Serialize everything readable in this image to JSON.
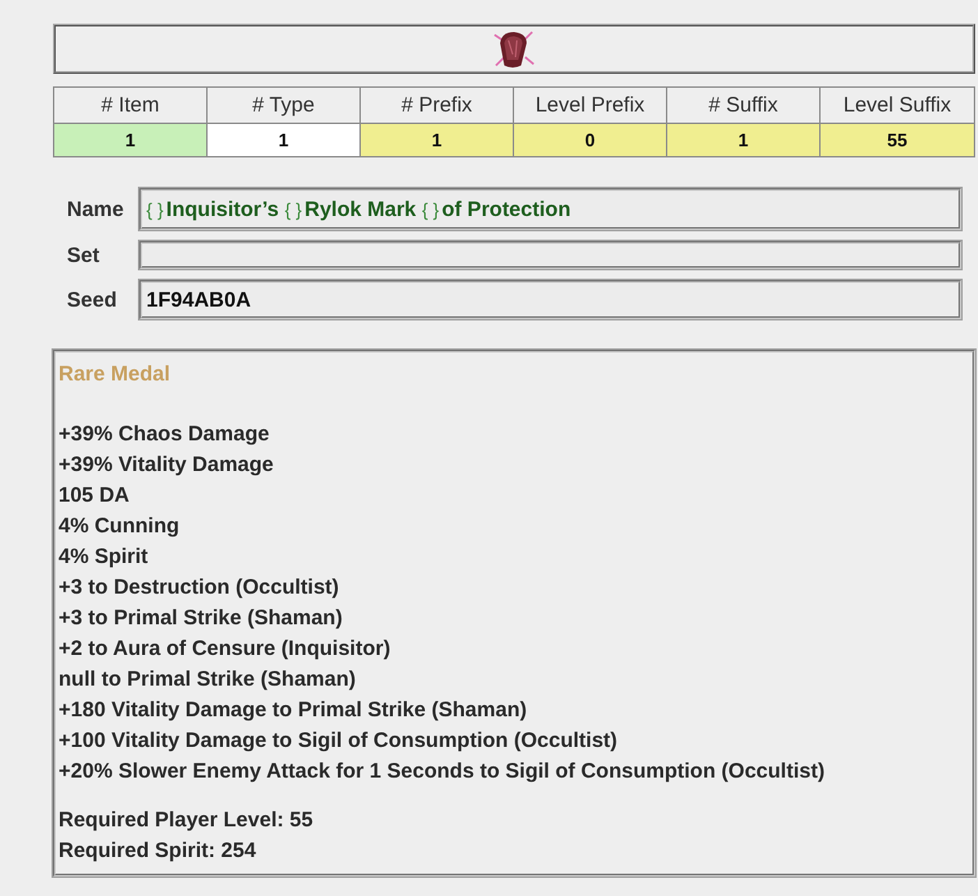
{
  "table": {
    "columns": [
      "# Item",
      "# Type",
      "# Prefix",
      "Level Prefix",
      "# Suffix",
      "Level Suffix"
    ],
    "row": [
      {
        "value": "1",
        "color": "#c8f0b8"
      },
      {
        "value": "1",
        "color": "#ffffff"
      },
      {
        "value": "1",
        "color": "#f0ee90"
      },
      {
        "value": "0",
        "color": "#f0ee90"
      },
      {
        "value": "1",
        "color": "#f0ee90"
      },
      {
        "value": "55",
        "color": "#f0ee90"
      }
    ]
  },
  "form": [
    {
      "label": "Name",
      "parts": [
        {
          "kind": "brace",
          "text": "{ }"
        },
        {
          "kind": "word",
          "text": "Inquisitor’s "
        },
        {
          "kind": "brace",
          "text": "{ }"
        },
        {
          "kind": "word",
          "text": "Rylok Mark "
        },
        {
          "kind": "brace",
          "text": "{ }"
        },
        {
          "kind": "word",
          "text": "of Protection"
        }
      ]
    },
    {
      "label": "Set"
    },
    {
      "label": "Seed",
      "parts": [
        {
          "kind": "plain",
          "text": "1F94AB0A"
        }
      ]
    }
  ],
  "description": {
    "title": "Rare Medal",
    "stats": [
      "+39% Chaos Damage",
      "+39% Vitality Damage",
      "105 DA",
      "4% Cunning",
      "4% Spirit",
      "+3 to Destruction (Occultist)",
      "+3 to Primal Strike (Shaman)",
      "+2 to Aura of Censure (Inquisitor)",
      "null to Primal Strike (Shaman)",
      "+180 Vitality Damage to Primal Strike (Shaman)",
      "+100 Vitality Damage to Sigil of Consumption (Occultist)",
      "+20% Slower Enemy Attack for 1 Seconds to Sigil of Consumption (Occultist)"
    ],
    "requirements": [
      "Required Player Level: 55",
      "Required Spirit: 254"
    ]
  }
}
